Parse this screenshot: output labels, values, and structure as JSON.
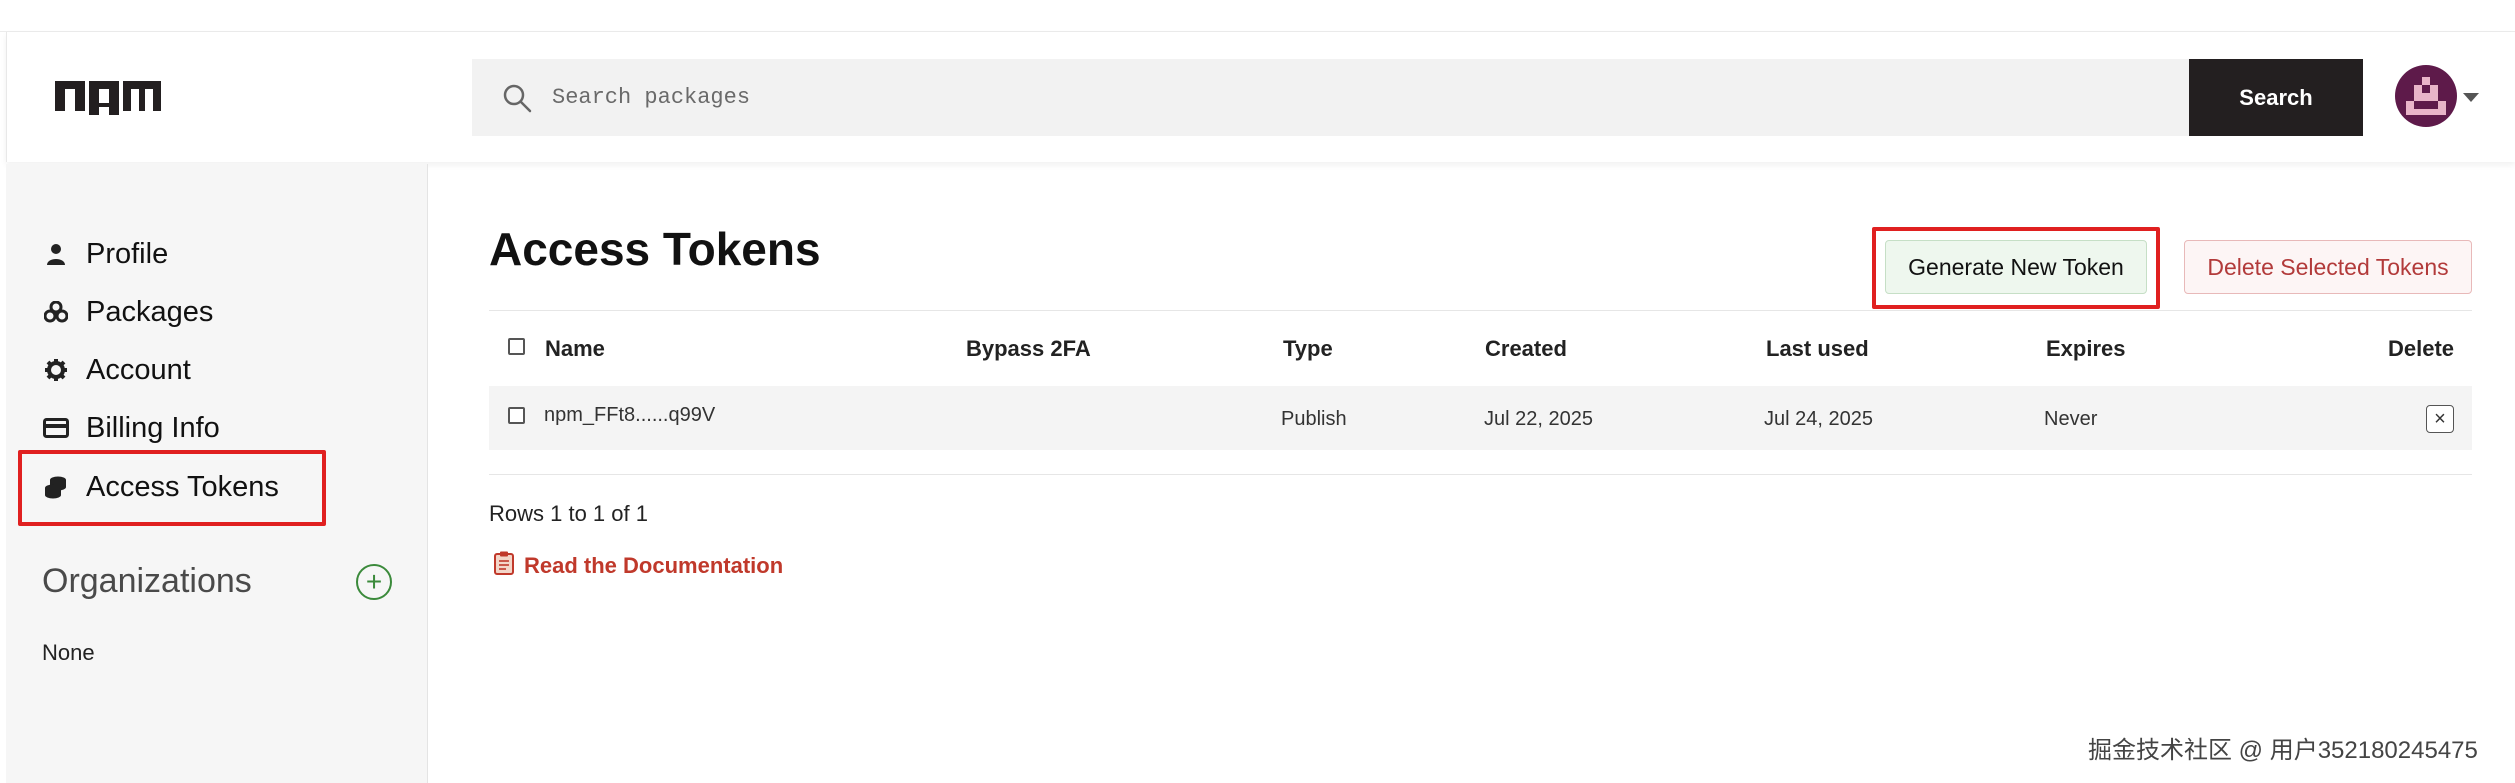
{
  "header": {
    "logo_text": "npm",
    "search_placeholder": "Search packages",
    "search_button": "Search",
    "avatar_icon": "pixel-avatar-icon"
  },
  "sidebar": {
    "items": [
      {
        "label": "Profile",
        "icon": "user-icon"
      },
      {
        "label": "Packages",
        "icon": "packages-icon"
      },
      {
        "label": "Account",
        "icon": "gear-icon"
      },
      {
        "label": "Billing Info",
        "icon": "credit-card-icon"
      },
      {
        "label": "Access Tokens",
        "icon": "tokens-icon",
        "highlighted": true
      }
    ],
    "organizations_title": "Organizations",
    "organizations_add": "+",
    "organizations_value": "None"
  },
  "main": {
    "title": "Access Tokens",
    "generate_button": "Generate New Token",
    "delete_selected_button": "Delete Selected Tokens",
    "table": {
      "columns": [
        "Name",
        "Bypass 2FA",
        "Type",
        "Created",
        "Last used",
        "Expires",
        "Delete"
      ],
      "rows": [
        {
          "name": "npm_FFt8......q99V",
          "bypass_2fa": "",
          "type": "Publish",
          "created": "Jul 22, 2025",
          "last_used": "Jul 24, 2025",
          "expires": "Never",
          "delete": "×"
        }
      ]
    },
    "rows_info": "Rows 1 to 1 of 1",
    "docs_link": "Read the Documentation"
  },
  "watermark": "掘金技术社区 @ 用户352180245475",
  "colors": {
    "highlight": "#e02020",
    "search_button_bg": "#231f20",
    "docs_link": "#c0392b",
    "avatar_bg": "#5e1a4a"
  }
}
